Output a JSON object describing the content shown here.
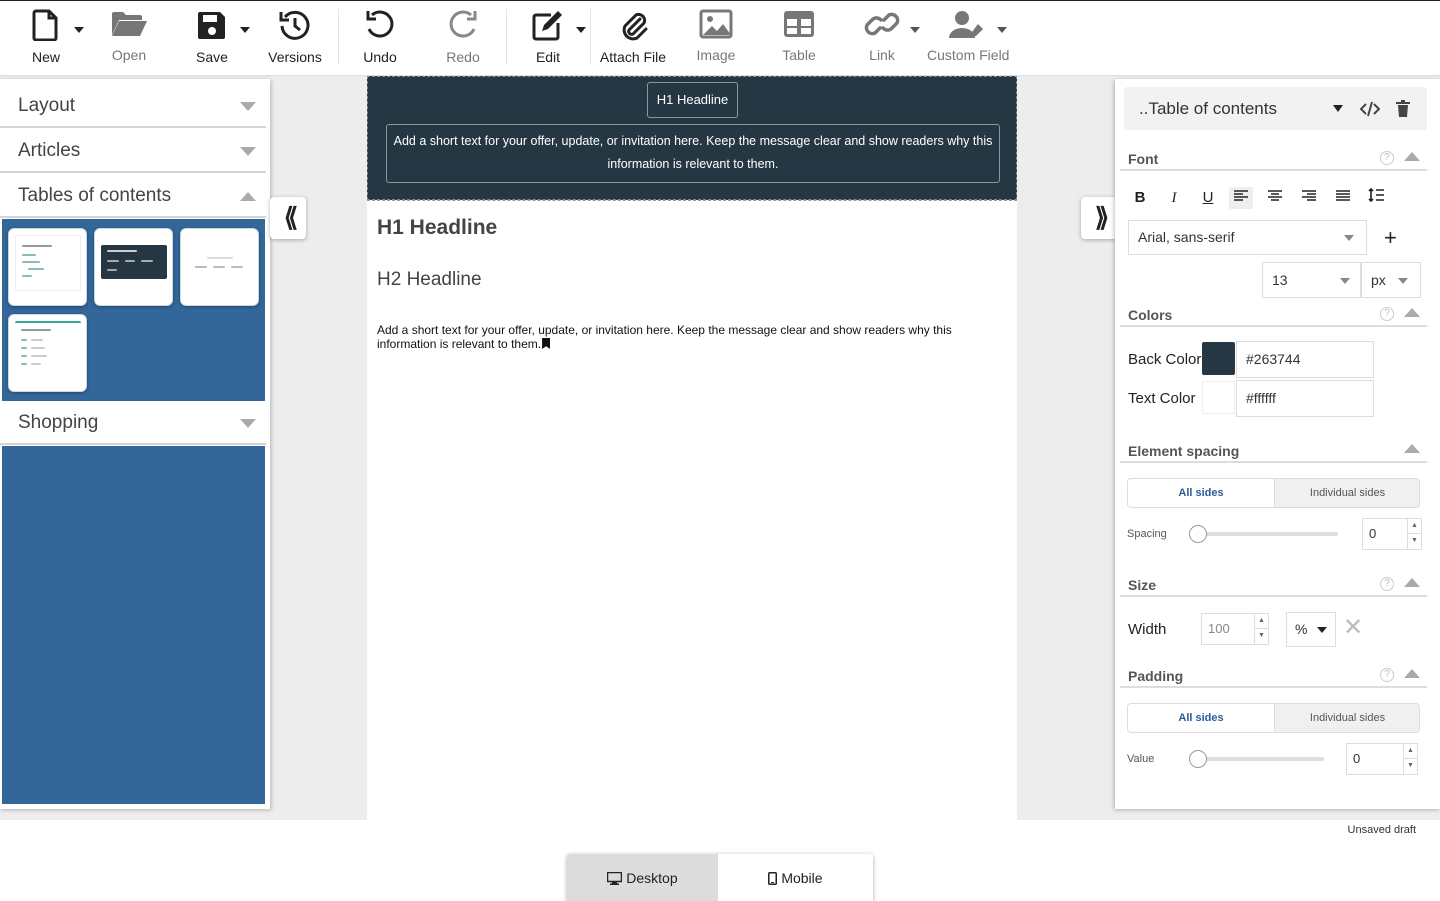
{
  "toolbar": {
    "new": "New",
    "open": "Open",
    "save": "Save",
    "versions": "Versions",
    "undo": "Undo",
    "redo": "Redo",
    "edit": "Edit",
    "attach": "Attach File",
    "image": "Image",
    "table": "Table",
    "link": "Link",
    "custom_field": "Custom Field"
  },
  "sidebar": {
    "sections": [
      {
        "label": "Layout",
        "expanded": false
      },
      {
        "label": "Articles",
        "expanded": false
      },
      {
        "label": "Tables of contents",
        "expanded": true
      },
      {
        "label": "Shopping",
        "expanded": false
      }
    ]
  },
  "canvas": {
    "hero_title": "H1 Headline",
    "hero_text": "Add a short text for your offer, update, or invitation here. Keep the message clear and show readers why this information is relevant to them.",
    "h1": "H1 Headline",
    "h2": "H2 Headline",
    "body": "Add a short text for your offer, update, or invitation here. Keep the message clear and show readers why this information is relevant to them."
  },
  "props": {
    "element": "..Table of contents",
    "font_title": "Font",
    "font_family": "Arial, sans-serif",
    "font_size": "13",
    "font_unit": "px",
    "colors_title": "Colors",
    "back_color_label": "Back Color",
    "back_color": "#263744",
    "text_color_label": "Text Color",
    "text_color": "#ffffff",
    "spacing_title": "Element spacing",
    "all_sides": "All sides",
    "individual_sides": "Individual sides",
    "spacing_label": "Spacing",
    "spacing_value": "0",
    "size_title": "Size",
    "width_label": "Width",
    "width_value": "100",
    "width_unit": "%",
    "padding_title": "Padding",
    "padding_all": "All sides",
    "padding_individual": "Individual sides",
    "value_label": "Value",
    "padding_value": "0"
  },
  "status": "Unsaved draft",
  "view": {
    "desktop": "Desktop",
    "mobile": "Mobile"
  },
  "colors": {
    "accent": "#336699",
    "hero_bg": "#263744"
  }
}
